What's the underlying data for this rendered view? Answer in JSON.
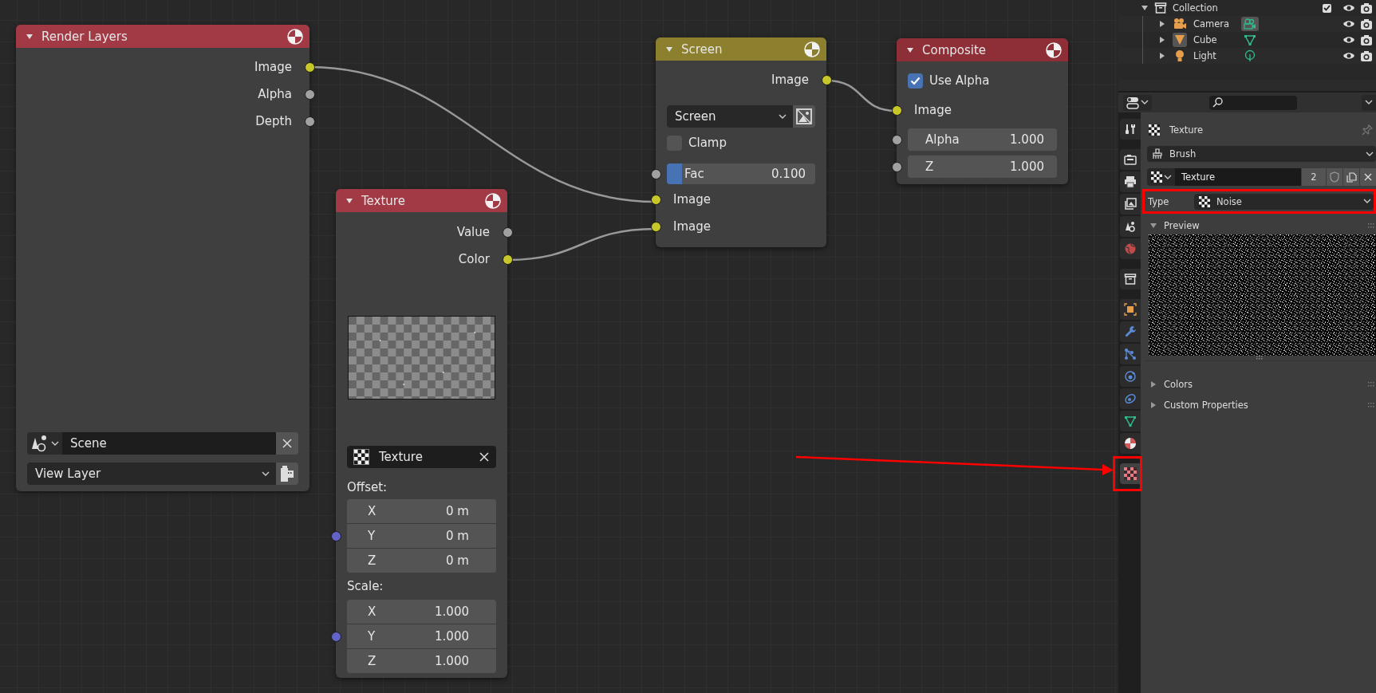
{
  "node_editor": {
    "nodes": [
      {
        "kind": "render_layers",
        "title": "Render Layers",
        "color": "#a23a45",
        "expanded": true,
        "rows": [
          {
            "kind": "output",
            "label": "Image",
            "color": "#c7c729"
          },
          {
            "kind": "output",
            "label": "Alpha",
            "color": "#a1a1a1"
          },
          {
            "kind": "output",
            "label": "Depth",
            "color": "#a1a1a1"
          },
          {
            "kind": "datablock",
            "value": "Scene"
          },
          {
            "kind": "dropdown",
            "value": "View Layer"
          }
        ]
      },
      {
        "kind": "mix",
        "title": "Screen",
        "color": "#8c7f2e",
        "expanded": true,
        "rows": [
          {
            "kind": "output",
            "label": "Image",
            "color": "#c7c729"
          },
          {
            "kind": "dropdown",
            "value": "Screen"
          },
          {
            "kind": "checkbox",
            "label": "Clamp",
            "checked": false
          },
          {
            "kind": "slider",
            "label": "Fac",
            "value": "0.100",
            "level": 0.1,
            "color": "#a1a1a1"
          },
          {
            "kind": "input",
            "label": "Image",
            "color": "#c7c729"
          },
          {
            "kind": "input",
            "label": "Image",
            "color": "#c7c729"
          }
        ]
      },
      {
        "kind": "composite",
        "title": "Composite",
        "color": "#8e2e36",
        "expanded": true,
        "rows": [
          {
            "kind": "checkbox",
            "label": "Use Alpha",
            "checked": true
          },
          {
            "kind": "input",
            "label": "Image",
            "color": "#c7c729"
          },
          {
            "kind": "value",
            "label": "Alpha",
            "value": "1.000",
            "color": "#a1a1a1"
          },
          {
            "kind": "value",
            "label": "Z",
            "value": "1.000",
            "color": "#a1a1a1"
          }
        ]
      },
      {
        "kind": "texture",
        "title": "Texture",
        "color": "#a23a45",
        "expanded": true,
        "rows": [
          {
            "kind": "output",
            "label": "Value",
            "color": "#a1a1a1"
          },
          {
            "kind": "output",
            "label": "Color",
            "color": "#c7c729"
          },
          {
            "kind": "preview"
          },
          {
            "kind": "datablock",
            "value": "Texture"
          },
          {
            "kind": "heading",
            "label": "Offset:"
          },
          {
            "kind": "vector",
            "color": "#6363c7",
            "items": [
              {
                "label": "X",
                "value": "0 m"
              },
              {
                "label": "Y",
                "value": "0 m"
              },
              {
                "label": "Z",
                "value": "0 m"
              }
            ]
          },
          {
            "kind": "heading",
            "label": "Scale:"
          },
          {
            "kind": "vector",
            "color": "#6363c7",
            "items": [
              {
                "label": "X",
                "value": "1.000"
              },
              {
                "label": "Y",
                "value": "1.000"
              },
              {
                "label": "Z",
                "value": "1.000"
              }
            ]
          }
        ]
      }
    ]
  },
  "outliner": {
    "rows": [
      {
        "kind": "collection",
        "label": "Collection",
        "expanded": true,
        "checked": true,
        "visible": true,
        "children": [
          {
            "kind": "camera",
            "label": "Camera",
            "expanded": false,
            "active": false,
            "data_active": true,
            "visible": true
          },
          {
            "kind": "mesh",
            "label": "Cube",
            "expanded": false,
            "active": true,
            "data_active": false,
            "visible": true
          },
          {
            "kind": "light",
            "label": "Light",
            "expanded": false,
            "active": false,
            "data_active": false,
            "visible": true
          }
        ]
      }
    ]
  },
  "properties": {
    "tabs": [
      {
        "kind": "tool",
        "selected": false,
        "highlighted": false
      },
      {
        "kind": "render",
        "selected": false,
        "highlighted": false
      },
      {
        "kind": "output",
        "selected": false,
        "highlighted": false
      },
      {
        "kind": "view_layer",
        "selected": false,
        "highlighted": false
      },
      {
        "kind": "scene",
        "selected": false,
        "highlighted": false
      },
      {
        "kind": "world",
        "selected": false,
        "highlighted": false
      },
      {
        "kind": "collection",
        "selected": false,
        "highlighted": false
      },
      {
        "kind": "object",
        "selected": false,
        "highlighted": false
      },
      {
        "kind": "modifiers",
        "selected": false,
        "highlighted": false
      },
      {
        "kind": "particles",
        "selected": false,
        "highlighted": false
      },
      {
        "kind": "physics",
        "selected": false,
        "highlighted": false
      },
      {
        "kind": "constraints",
        "selected": false,
        "highlighted": false
      },
      {
        "kind": "data",
        "selected": false,
        "highlighted": false
      },
      {
        "kind": "material",
        "selected": false,
        "highlighted": false
      },
      {
        "kind": "texture",
        "selected": true,
        "highlighted": true
      }
    ],
    "context": "Texture",
    "brush": "Brush",
    "texture": {
      "name": "Texture",
      "users": "2"
    },
    "type": {
      "label": "Type",
      "value": "Noise",
      "highlighted": true
    },
    "panels": [
      {
        "label": "Preview",
        "expanded": true
      },
      {
        "label": "Colors",
        "expanded": false
      },
      {
        "label": "Custom Properties",
        "expanded": false
      }
    ]
  }
}
